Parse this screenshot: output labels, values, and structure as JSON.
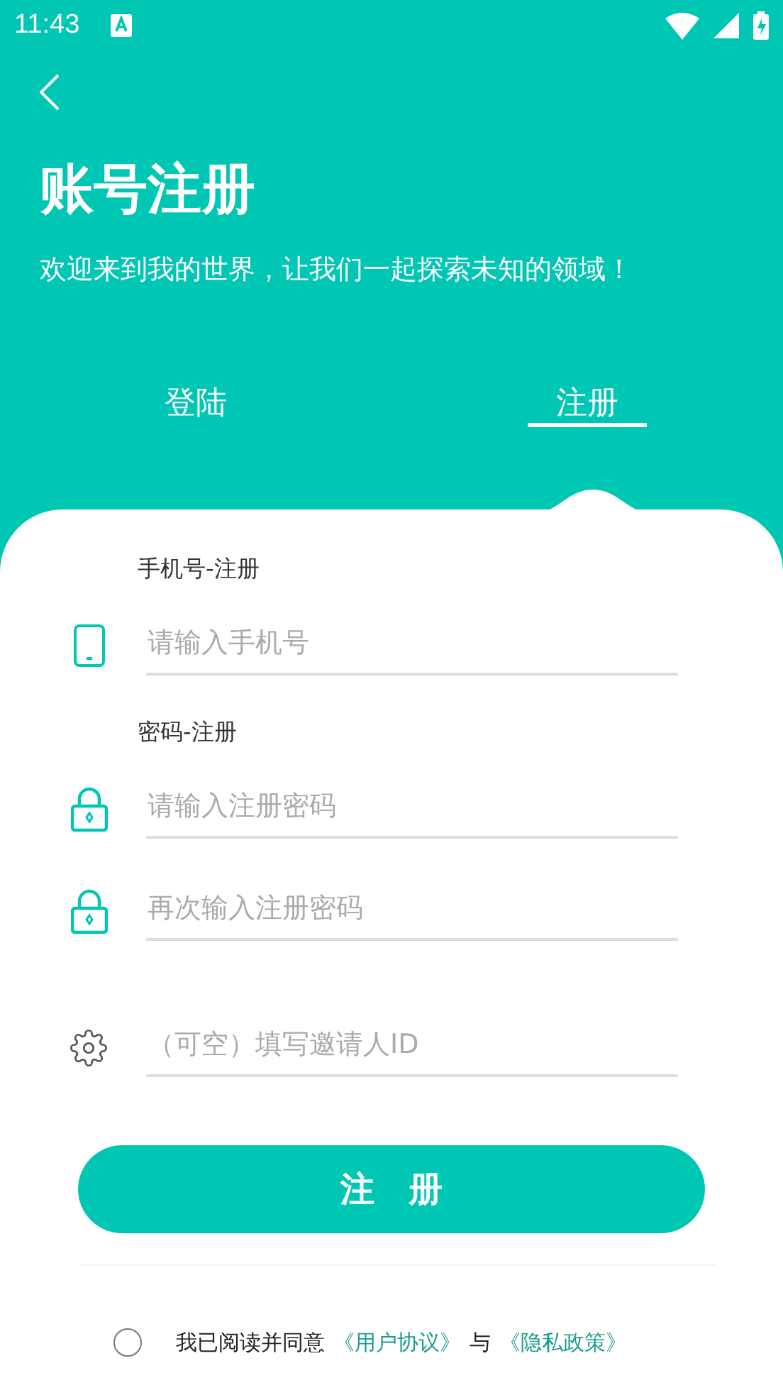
{
  "status_bar": {
    "time": "11:43"
  },
  "header": {
    "title": "账号注册",
    "subtitle": "欢迎来到我的世界，让我们一起探索未知的领域！"
  },
  "tabs": [
    {
      "label": "登陆",
      "selected": false
    },
    {
      "label": "注册",
      "selected": true
    }
  ],
  "form": [
    {
      "kind": "phone",
      "label": "手机号-注册",
      "placeholder": "请输入手机号"
    },
    {
      "kind": "lock",
      "label": "密码-注册",
      "placeholder": "请输入注册密码"
    },
    {
      "kind": "lock",
      "placeholder": "再次输入注册密码"
    },
    {
      "kind": "gear",
      "placeholder": "（可空）填写邀请人ID"
    }
  ],
  "submit": "注　册",
  "agreement": {
    "checked": false,
    "text": "我已阅读并同意",
    "link1": "《用户协议》",
    "joiner": "与",
    "link2": "《隐私政策》"
  }
}
